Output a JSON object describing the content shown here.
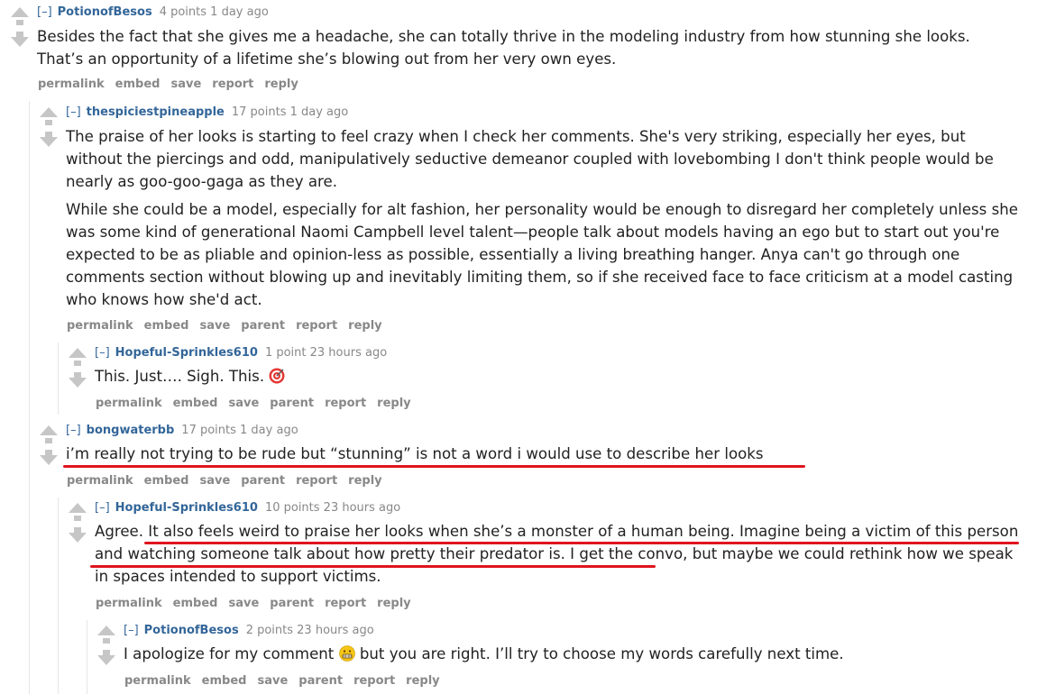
{
  "comments": [
    {
      "author": "PotionofBesos",
      "toggle": "[–]",
      "meta": "4 points 1 day ago",
      "text": [
        "Besides the fact that she gives me a headache, she can totally thrive in the modeling industry from how stunning she looks. That’s an opportunity of a lifetime she’s blowing out from her very own eyes."
      ],
      "buttons": [
        "permalink",
        "embed",
        "save",
        "report",
        "reply"
      ]
    },
    {
      "author": "thespiciestpineapple",
      "toggle": "[–]",
      "meta": "17 points 1 day ago",
      "text": [
        "The praise of her looks is starting to feel crazy when I check her comments. She's very striking, especially her eyes, but without the piercings and odd, manipulatively seductive demeanor coupled with lovebombing I don't think people would be nearly as goo-goo-gaga as they are.",
        "While she could be a model, especially for alt fashion, her personality would be enough to disregard her completely unless she was some kind of generational Naomi Campbell level talent—people talk about models having an ego but to start out you're expected to be as pliable and opinion-less as possible, essentially a living breathing hanger. Anya can't go through one comments section without blowing up and inevitably limiting them, so if she received face to face criticism at a model casting who knows how she'd act."
      ],
      "buttons": [
        "permalink",
        "embed",
        "save",
        "parent",
        "report",
        "reply"
      ]
    },
    {
      "author": "Hopeful-Sprinkles610",
      "toggle": "[–]",
      "meta": "1 point 23 hours ago",
      "text": [
        "This. Just…. Sigh. This."
      ],
      "emoji": "target-emoji",
      "buttons": [
        "permalink",
        "embed",
        "save",
        "parent",
        "report",
        "reply"
      ]
    },
    {
      "author": "bongwaterbb",
      "toggle": "[–]",
      "meta": "17 points 1 day ago",
      "text": [
        "i’m really not trying to be rude but “stunning” is not a word i would use to describe her looks"
      ],
      "buttons": [
        "permalink",
        "embed",
        "save",
        "parent",
        "report",
        "reply"
      ]
    },
    {
      "author": "Hopeful-Sprinkles610",
      "toggle": "[–]",
      "meta": "10 points 23 hours ago",
      "text": [
        "Agree. It also feels weird to praise her looks when she’s a monster of a human being. Imagine being a victim of this person and watching someone talk about how pretty their predator is. I get the convo, but maybe we could rethink how we speak in spaces intended to support victims."
      ],
      "buttons": [
        "permalink",
        "embed",
        "save",
        "parent",
        "report",
        "reply"
      ]
    },
    {
      "author": "PotionofBesos",
      "toggle": "[–]",
      "meta": "2 points 23 hours ago",
      "text_before": "I apologize for my comment",
      "emoji": "grimace-emoji",
      "text_after": "but you are right. I’ll try to choose my words carefully next time.",
      "buttons": [
        "permalink",
        "embed",
        "save",
        "parent",
        "report",
        "reply"
      ]
    }
  ],
  "colors": {
    "author": "#336699",
    "meta": "#888888",
    "underline": "#e0141e",
    "arrow": "#c6c6c6"
  }
}
